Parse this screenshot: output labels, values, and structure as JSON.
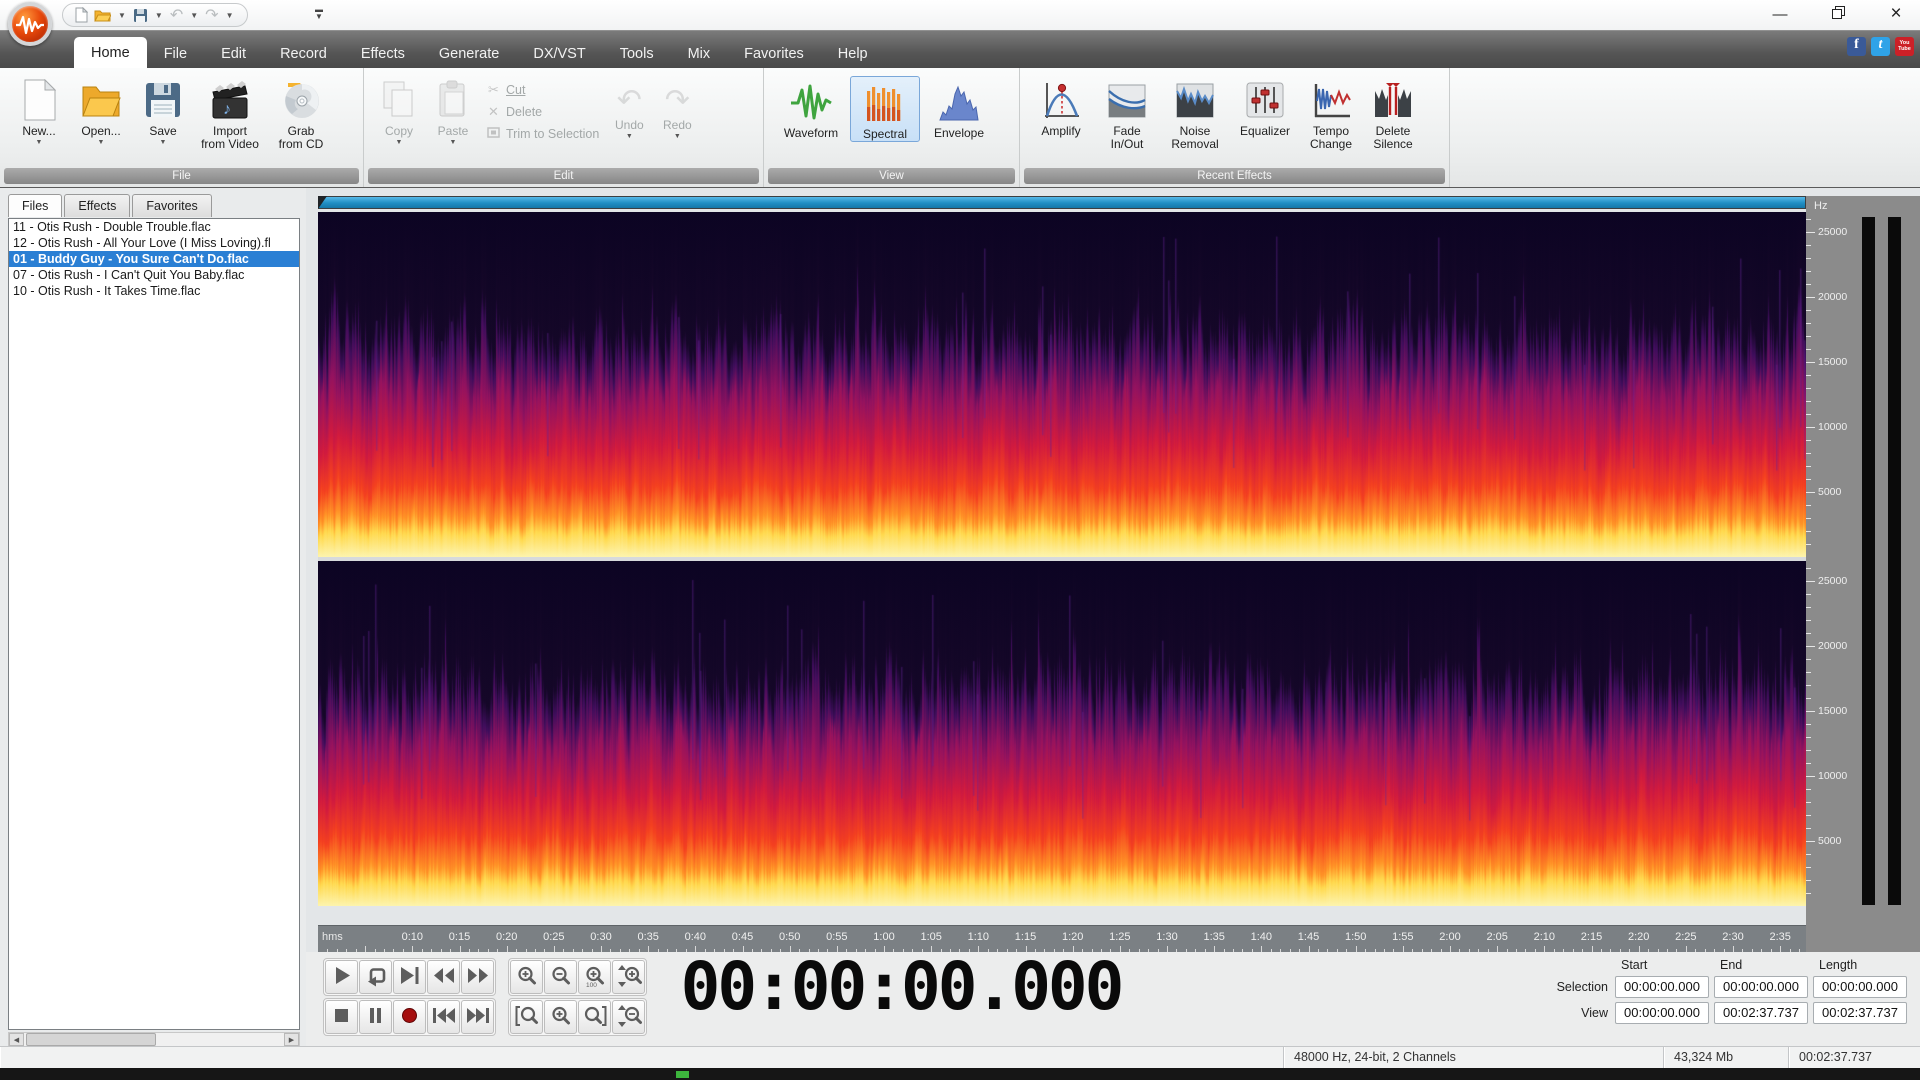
{
  "window": {
    "minimize": "—",
    "close": "×"
  },
  "menu": {
    "tabs": [
      {
        "label": "Home",
        "active": true
      },
      {
        "label": "File"
      },
      {
        "label": "Edit"
      },
      {
        "label": "Record"
      },
      {
        "label": "Effects"
      },
      {
        "label": "Generate"
      },
      {
        "label": "DX/VST"
      },
      {
        "label": "Tools"
      },
      {
        "label": "Mix"
      },
      {
        "label": "Favorites"
      },
      {
        "label": "Help"
      }
    ],
    "social": {
      "facebook": "f",
      "twitter": "t",
      "youtube": "You\nTube"
    }
  },
  "ribbon": {
    "captions": {
      "file": "File",
      "edit": "Edit",
      "view": "View",
      "recent": "Recent Effects"
    },
    "file": {
      "new": "New...",
      "open": "Open...",
      "save": "Save",
      "import_video": "Import\nfrom Video",
      "grab_cd": "Grab\nfrom CD"
    },
    "edit": {
      "copy": "Copy",
      "paste": "Paste",
      "cut": "Cut",
      "delete": "Delete",
      "trim": "Trim to Selection",
      "undo": "Undo",
      "redo": "Redo"
    },
    "view": {
      "waveform": "Waveform",
      "spectral": "Spectral",
      "envelope": "Envelope"
    },
    "recent": {
      "amplify": "Amplify",
      "fade": "Fade\nIn/Out",
      "noise": "Noise\nRemoval",
      "equalizer": "Equalizer",
      "tempo": "Tempo\nChange",
      "silence": "Delete\nSilence"
    }
  },
  "panel": {
    "tabs": [
      {
        "label": "Files",
        "active": true
      },
      {
        "label": "Effects"
      },
      {
        "label": "Favorites"
      }
    ],
    "files": [
      "11 - Otis Rush - Double Trouble.flac",
      "12 - Otis Rush - All Your Love (I Miss Loving).fl",
      "01 - Buddy Guy - You Sure Can't Do.flac",
      "07 - Otis Rush - I Can't Quit You Baby.flac",
      "10 - Otis Rush - It Takes Time.flac"
    ],
    "selected_index": 2
  },
  "wave": {
    "freq_axis": {
      "unit": "Hz",
      "max": 26500,
      "major_step": 5000,
      "minor_step": 1000,
      "labels": [
        "25000",
        "20000",
        "15000",
        "10000",
        "5000"
      ]
    },
    "timeline": {
      "unit": "hms",
      "duration_s": 157.737,
      "ticks": [
        "0:10",
        "0:15",
        "0:20",
        "0:25",
        "0:30",
        "0:35",
        "0:40",
        "0:45",
        "0:50",
        "0:55",
        "1:00",
        "1:05",
        "1:10",
        "1:15",
        "1:20",
        "1:25",
        "1:30",
        "1:35",
        "1:40",
        "1:45",
        "1:50",
        "1:55",
        "2:00",
        "2:05",
        "2:10",
        "2:15",
        "2:20",
        "2:25",
        "2:30",
        "2:35"
      ]
    }
  },
  "transport": {
    "rows": [
      [
        "play",
        "loop",
        "play-to-end",
        "rewind",
        "fast-forward"
      ],
      [
        "stop",
        "pause",
        "record",
        "go-to-start",
        "go-to-end"
      ]
    ]
  },
  "zoombar": {
    "rows": [
      [
        "zoom-in",
        "zoom-out",
        "zoom-100",
        "zoom-vertical-in"
      ],
      [
        "zoom-selection",
        "zoom-in-horizontal",
        "zoom-all",
        "zoom-vertical-out"
      ]
    ],
    "zoom_100_label": "100"
  },
  "time_display": {
    "value": "00:00:00.000"
  },
  "position_panel": {
    "headers": [
      "Start",
      "End",
      "Length"
    ],
    "rows": [
      {
        "label": "Selection",
        "values": [
          "00:00:00.000",
          "00:00:00.000",
          "00:00:00.000"
        ]
      },
      {
        "label": "View",
        "values": [
          "00:00:00.000",
          "00:02:37.737",
          "00:02:37.737"
        ]
      }
    ]
  },
  "status": {
    "audio": "48000 Hz, 24-bit, 2 Channels",
    "size": "43,324 Mb",
    "duration": "00:02:37.737"
  }
}
